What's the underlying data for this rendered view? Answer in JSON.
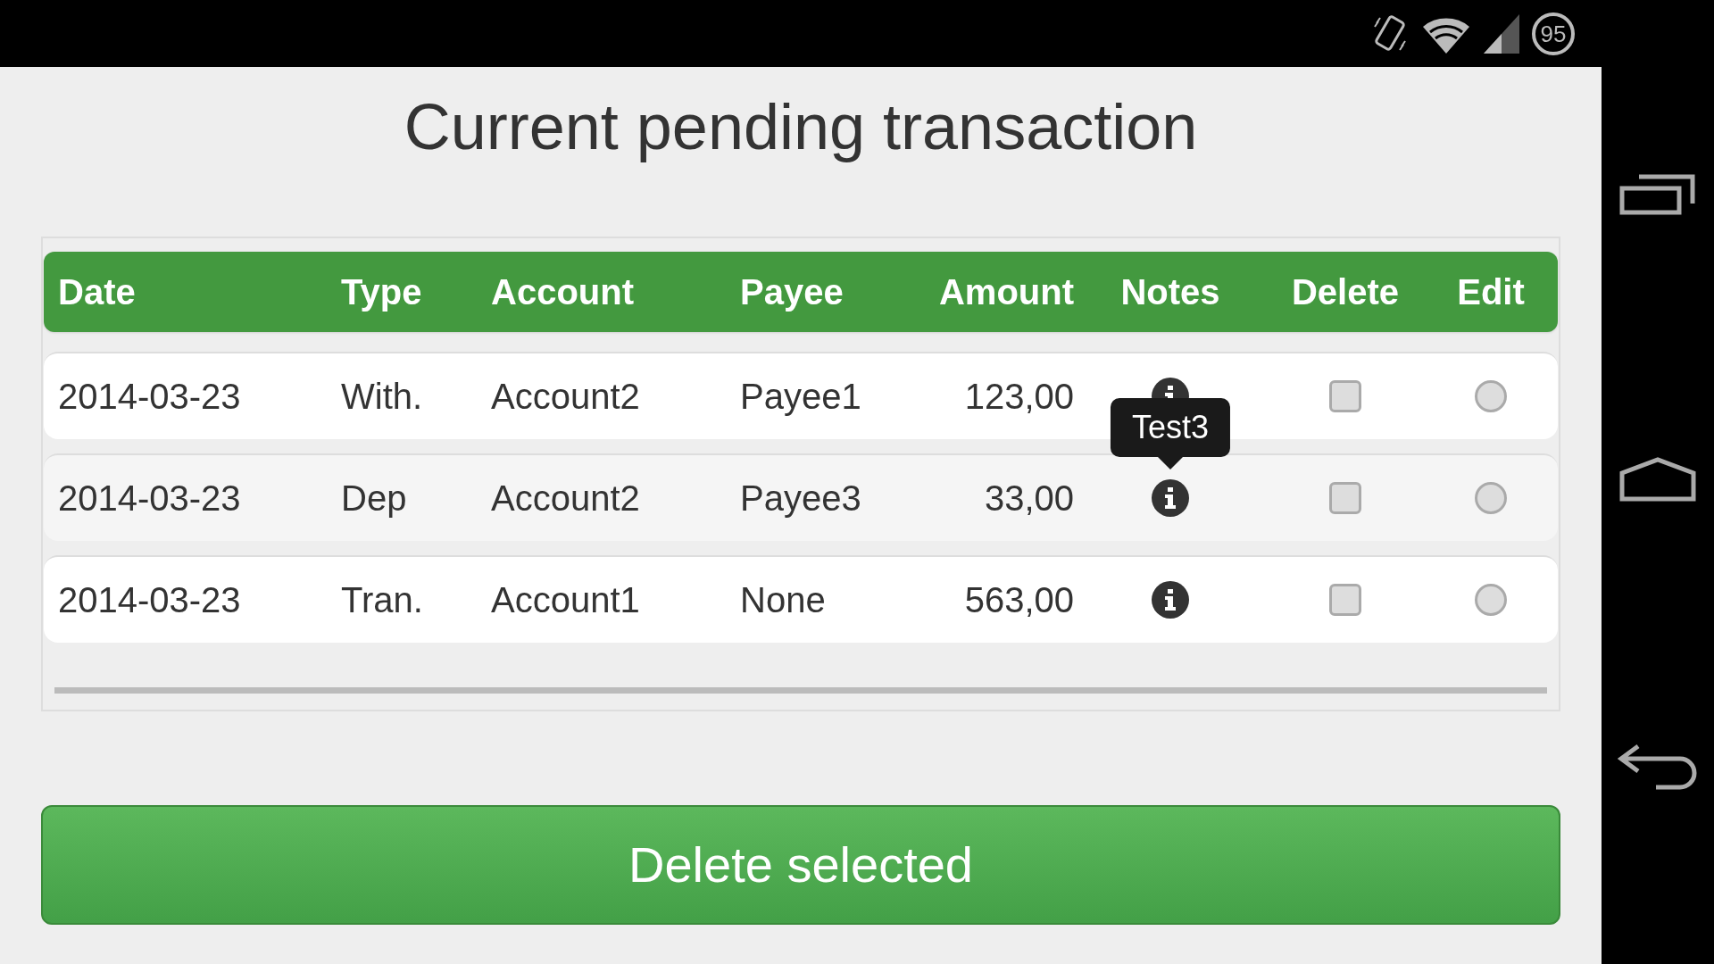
{
  "status_bar": {
    "battery": "95"
  },
  "title": "Current pending transaction",
  "table": {
    "columns": [
      "Date",
      "Type",
      "Account",
      "Payee",
      "Amount",
      "Notes",
      "Delete",
      "Edit"
    ],
    "rows": [
      {
        "date": "2014-03-23",
        "type": "With.",
        "account": "Account2",
        "payee": "Payee1",
        "amount": "123,00",
        "delete": {
          "checked": false
        },
        "edit": {
          "selected": false
        }
      },
      {
        "date": "2014-03-23",
        "type": "Dep",
        "account": "Account2",
        "payee": "Payee3",
        "amount": "33,00",
        "tooltip": "Test3",
        "delete": {
          "checked": false
        },
        "edit": {
          "selected": false
        }
      },
      {
        "date": "2014-03-23",
        "type": "Tran.",
        "account": "Account1",
        "payee": "None",
        "amount": "563,00",
        "delete": {
          "checked": false
        },
        "edit": {
          "selected": false
        }
      }
    ]
  },
  "delete_button": "Delete selected"
}
